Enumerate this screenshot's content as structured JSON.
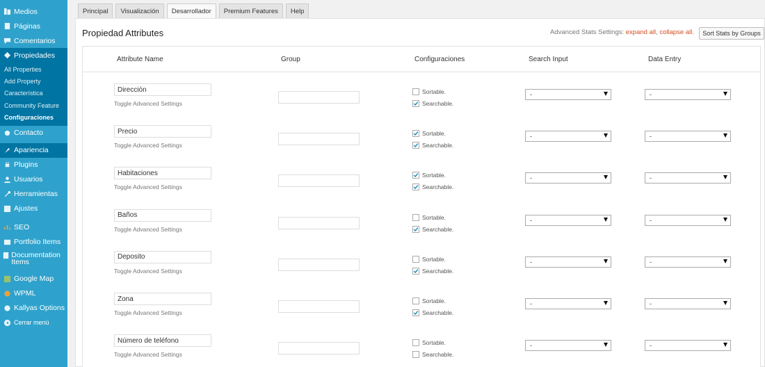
{
  "sidebar": {
    "top_items": [
      {
        "label": "Medios",
        "icon": "media-icon"
      },
      {
        "label": "Páginas",
        "icon": "pages-icon"
      },
      {
        "label": "Comentarios",
        "icon": "comments-icon"
      },
      {
        "label": "Propiedades",
        "icon": "properties-icon"
      }
    ],
    "submenu": [
      {
        "label": "All Properties"
      },
      {
        "label": "Add Property"
      },
      {
        "label": "Característica"
      },
      {
        "label": "Community Feature"
      },
      {
        "label": "Configuraciones"
      }
    ],
    "bottom_items": [
      {
        "label": "Contacto",
        "icon": "contact-icon"
      },
      {
        "label": "Apariencia",
        "icon": "appearance-icon"
      },
      {
        "label": "Plugins",
        "icon": "plugins-icon"
      },
      {
        "label": "Usuarios",
        "icon": "users-icon"
      },
      {
        "label": "Herramientas",
        "icon": "tools-icon"
      },
      {
        "label": "Ajustes",
        "icon": "settings-icon"
      },
      {
        "label": "SEO",
        "icon": "seo-icon"
      },
      {
        "label": "Portfolio Items",
        "icon": "portfolio-icon"
      },
      {
        "label": "Documentation Items",
        "icon": "documentation-icon"
      },
      {
        "label": "Google Map",
        "icon": "map-icon"
      },
      {
        "label": "WPML",
        "icon": "wpml-icon"
      },
      {
        "label": "Kallyas Options",
        "icon": "kallyas-icon"
      },
      {
        "label": "Cerrar menú",
        "icon": "collapse-icon"
      }
    ]
  },
  "tabs": [
    {
      "label": "Principal"
    },
    {
      "label": "Visualización"
    },
    {
      "label": "Desarrollador"
    },
    {
      "label": "Premium Features"
    },
    {
      "label": "Help"
    }
  ],
  "panel": {
    "title": "Propiedad Attributes",
    "stats_prefix": "Advanced Stats Settings:",
    "expand_all": "expand all",
    "separator": ",",
    "collapse_all": "collapse all.",
    "sort_button": "Sort Stats by Groups"
  },
  "table": {
    "headers": {
      "name": "Attribute Name",
      "group": "Group",
      "config": "Configuraciones",
      "search": "Search Input",
      "entry": "Data Entry"
    },
    "toggle_label": "Toggle Advanced Settings",
    "sortable_label": "Sortable.",
    "searchable_label": "Searchable.",
    "select_value": "-",
    "rows": [
      {
        "name": "Dirección",
        "group": "",
        "sortable": false,
        "searchable": true
      },
      {
        "name": "Precio",
        "group": "",
        "sortable": true,
        "searchable": true
      },
      {
        "name": "Habitaciones",
        "group": "",
        "sortable": true,
        "searchable": true
      },
      {
        "name": "Baños",
        "group": "",
        "sortable": false,
        "searchable": true
      },
      {
        "name": "Deposito",
        "group": "",
        "sortable": false,
        "searchable": true
      },
      {
        "name": "Zona",
        "group": "",
        "sortable": false,
        "searchable": true
      },
      {
        "name": "Número de teléfono",
        "group": "",
        "sortable": false,
        "searchable": false
      }
    ]
  }
}
